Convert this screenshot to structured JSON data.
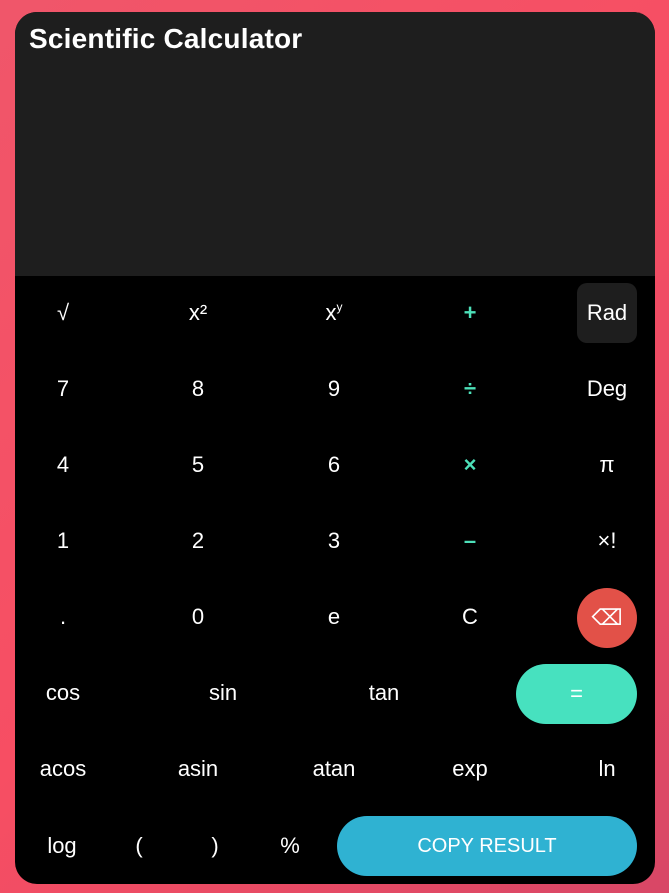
{
  "app": {
    "title": "Scientific Calculator"
  },
  "keys": {
    "sqrt": "√",
    "square": "x²",
    "power_base": "x",
    "power_exp": "y",
    "add": "+",
    "rad": "Rad",
    "seven": "7",
    "eight": "8",
    "nine": "9",
    "divide": "÷",
    "deg": "Deg",
    "four": "4",
    "five": "5",
    "six": "6",
    "multiply": "×",
    "pi": "π",
    "one": "1",
    "two": "2",
    "three": "3",
    "subtract": "–",
    "factorial": "×!",
    "decimal": ".",
    "zero": "0",
    "euler": "e",
    "clear": "C",
    "backspace": "⌫",
    "cos": "cos",
    "sin": "sin",
    "tan": "tan",
    "equals": "=",
    "acos": "acos",
    "asin": "asin",
    "atan": "atan",
    "exp": "exp",
    "ln": "ln",
    "log": "log",
    "open_paren": "(",
    "close_paren": ")",
    "percent": "%",
    "copy": "COPY RESULT"
  },
  "colors": {
    "operator": "#4de0b9",
    "equals_bg": "#47e1bf",
    "copy_bg": "#2fb2d2",
    "backspace_bg": "#e25148",
    "display_bg": "#1e1e1e"
  }
}
